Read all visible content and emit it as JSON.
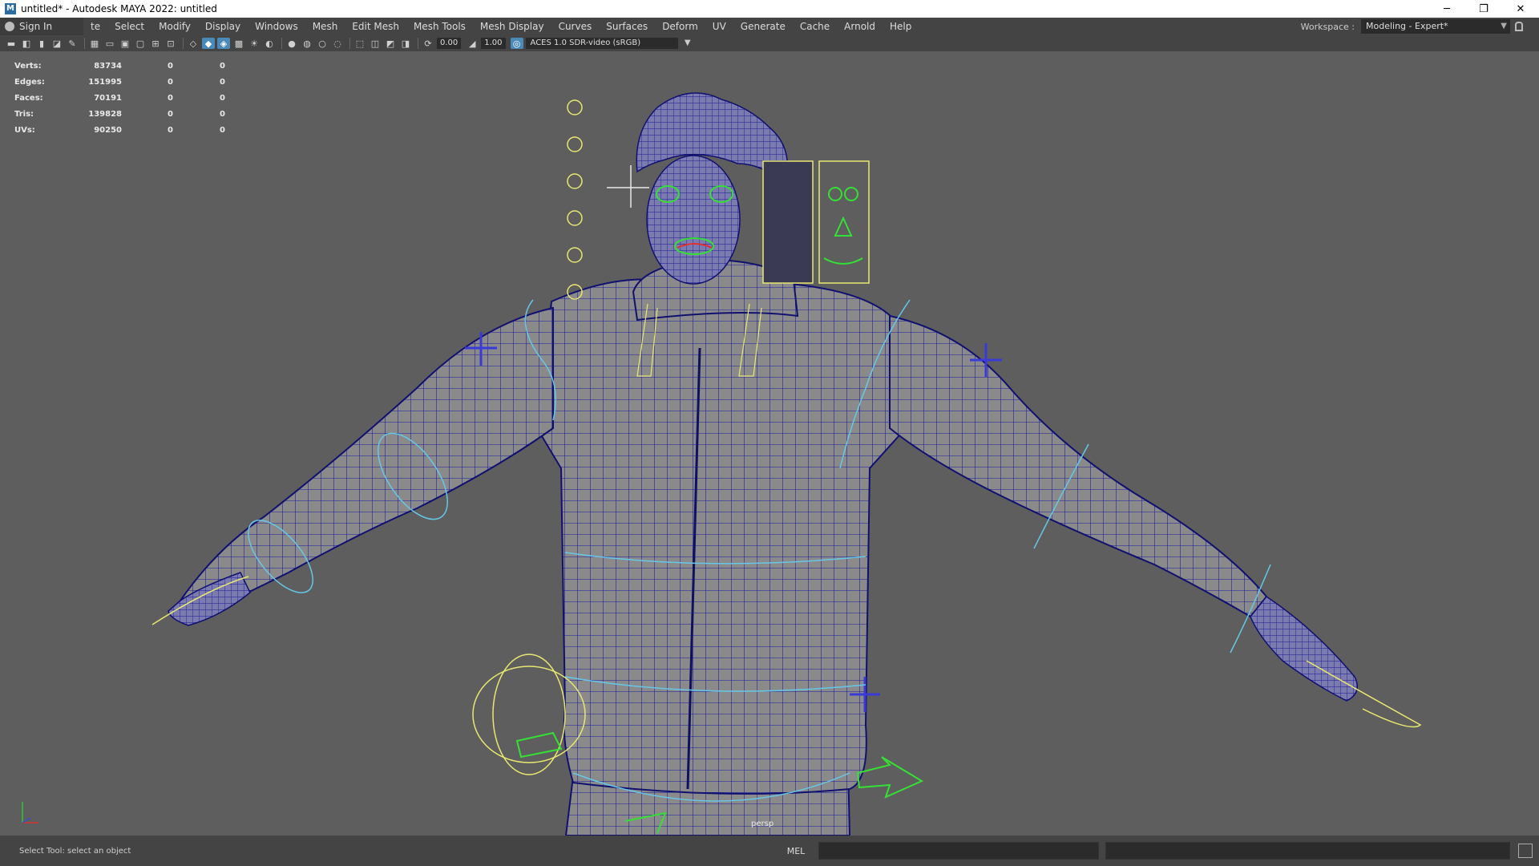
{
  "window": {
    "app_icon": "M",
    "title": "untitled* - Autodesk MAYA 2022: untitled",
    "controls": [
      "─",
      "❐",
      "✕"
    ]
  },
  "menubar": {
    "sign_in": "Sign In",
    "items": [
      "te",
      "Select",
      "Modify",
      "Display",
      "Windows",
      "Mesh",
      "Edit Mesh",
      "Mesh Tools",
      "Mesh Display",
      "Curves",
      "Surfaces",
      "Deform",
      "UV",
      "Generate",
      "Cache",
      "Arnold",
      "Help"
    ],
    "workspace_label": "Workspace :",
    "workspace_value": "Modeling - Expert*"
  },
  "toolbar": {
    "exposure": "0.00",
    "gamma": "1.00",
    "color_management": "ACES 1.0 SDR-video (sRGB)"
  },
  "hud": {
    "rows": [
      {
        "label": "Verts:",
        "v1": "83734",
        "v2": "0",
        "v3": "0"
      },
      {
        "label": "Edges:",
        "v1": "151995",
        "v2": "0",
        "v3": "0"
      },
      {
        "label": "Faces:",
        "v1": "70191",
        "v2": "0",
        "v3": "0"
      },
      {
        "label": "Tris:",
        "v1": "139828",
        "v2": "0",
        "v3": "0"
      },
      {
        "label": "UVs:",
        "v1": "90250",
        "v2": "0",
        "v3": "0"
      }
    ]
  },
  "viewport": {
    "camera_label": "persp",
    "colors": {
      "background": "#5e5e5e",
      "wireframe": "#1a1aa0",
      "mesh": "#8a8a8a",
      "controller_yellow": "#e8e870",
      "controller_cyan": "#66c8e8",
      "controller_green": "#35e035"
    }
  },
  "statusbar": {
    "help_text": "Select Tool: select an object",
    "command_language": "MEL"
  }
}
